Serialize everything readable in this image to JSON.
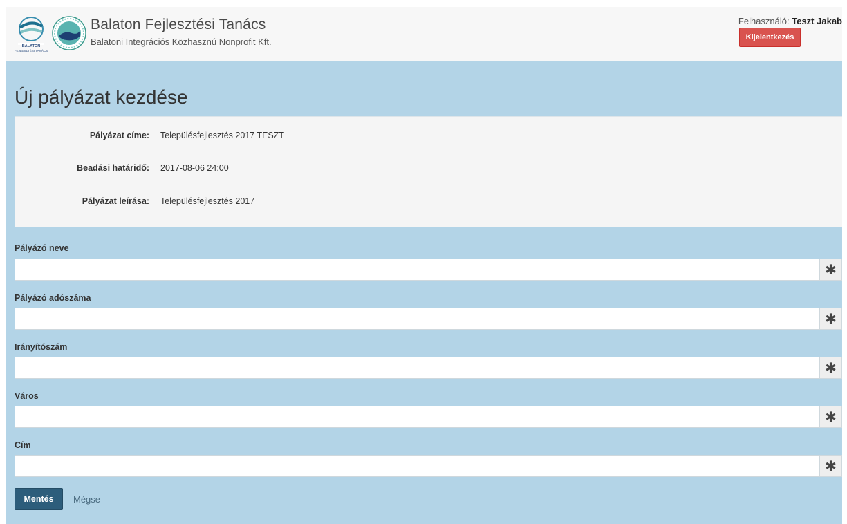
{
  "header": {
    "title": "Balaton Fejlesztési Tanács",
    "subtitle": "Balatoni Integrációs Közhasznú Nonprofit Kft.",
    "logos": [
      "balaton-fejlesztesi-tanacs-logo",
      "balatoni-integracios-kft-logo"
    ],
    "user_label": "Felhasználó:",
    "user_name": "Teszt Jakab",
    "logout_label": "Kijelentkezés"
  },
  "page": {
    "title": "Új pályázat kezdése"
  },
  "info": [
    {
      "label": "Pályázat címe:",
      "value": "Településfejlesztés 2017 TESZT"
    },
    {
      "label": "Beadási határidő:",
      "value": "2017-08-06 24:00"
    },
    {
      "label": "Pályázat leírása:",
      "value": "Településfejlesztés 2017"
    }
  ],
  "form": {
    "fields": [
      {
        "label": "Pályázó neve",
        "value": "",
        "required_marker": "✱"
      },
      {
        "label": "Pályázó adószáma",
        "value": "",
        "required_marker": "✱"
      },
      {
        "label": "Irányítószám",
        "value": "",
        "required_marker": "✱"
      },
      {
        "label": "Város",
        "value": "",
        "required_marker": "✱"
      },
      {
        "label": "Cím",
        "value": "",
        "required_marker": "✱"
      }
    ],
    "save_label": "Mentés",
    "cancel_label": "Mégse"
  },
  "colors": {
    "background": "#b3d4e7",
    "header_bg": "#f7f7f7",
    "panel_bg": "#f5f5f5",
    "logout_button": "#d9534f",
    "save_button": "#2d5d7b"
  }
}
